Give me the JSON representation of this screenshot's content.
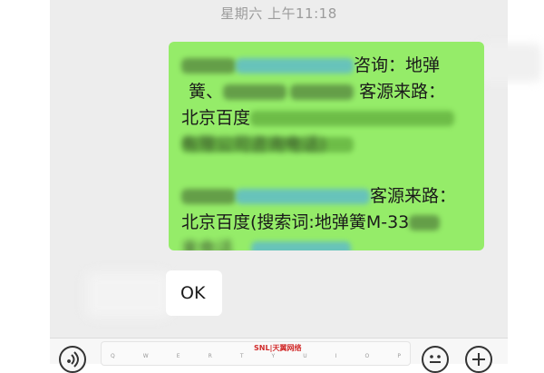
{
  "chat": {
    "timestamp": "星期六 上午11:18",
    "sent_message": {
      "line1_end": "咨询：地弹",
      "line2_end": "客源来路：",
      "line3_start": "北京百度",
      "line5_end": "客源来路：",
      "line6": "北京百度(搜索词:地弹簧M-33",
      "blurred_line4": "有限公司咨询电话)",
      "blurred_line7": "来电话"
    },
    "received_message": "OK"
  },
  "input_bar": {
    "brand_text": "SNL|天翼网络",
    "keys": [
      "Q",
      "W",
      "E",
      "R",
      "T",
      "Y",
      "U",
      "I",
      "O",
      "P"
    ]
  }
}
